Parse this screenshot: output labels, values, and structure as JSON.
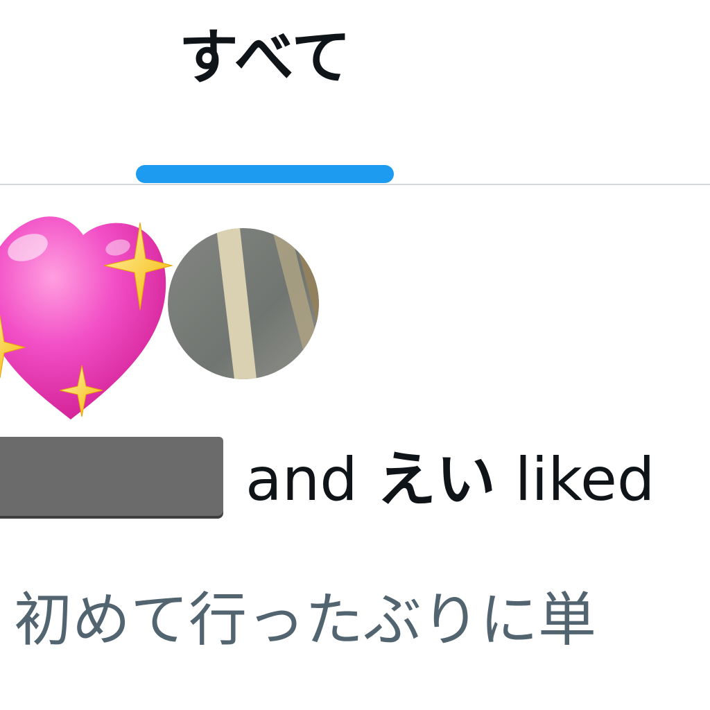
{
  "tabs": {
    "all_label": "すべて",
    "active_color": "#1d9bf0"
  },
  "notification": {
    "type_icon": "sparkling-heart-icon",
    "avatar_icon": "road-photo-avatar",
    "conjunction": "and",
    "second_user": "えい",
    "action_text": "liked",
    "tweet_preview": "初めて行ったぶりに単"
  },
  "colors": {
    "primary_text": "#0f1419",
    "secondary_text": "#536471",
    "divider": "#cfd9de",
    "redaction": "#6b6b6b"
  }
}
